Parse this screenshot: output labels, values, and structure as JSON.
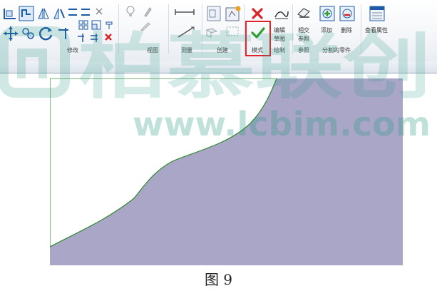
{
  "ribbon": {
    "panels": {
      "modify": "修改",
      "view": "视图",
      "measure": "测量",
      "create": "创建",
      "mode": "模式",
      "draw": "绘制",
      "reference": "参照",
      "parts": "分割的零件"
    },
    "buttons": {
      "edit_sketch": [
        "编辑",
        "草图"
      ],
      "relative_reference": [
        "相交",
        "参照"
      ],
      "add": "添加",
      "delete": "删除",
      "view_properties": "查看属性"
    }
  },
  "watermark": {
    "brand": "柏慕联创",
    "url": "www.lcbim.com"
  },
  "colors": {
    "sheet_fill": "#aaa6c8",
    "sheet_edge": "#2d8a2d",
    "finish_check": "#2e9e2e",
    "cancel_x": "#d9232b",
    "highlight_box": "#e0242a"
  },
  "caption": "图 9"
}
